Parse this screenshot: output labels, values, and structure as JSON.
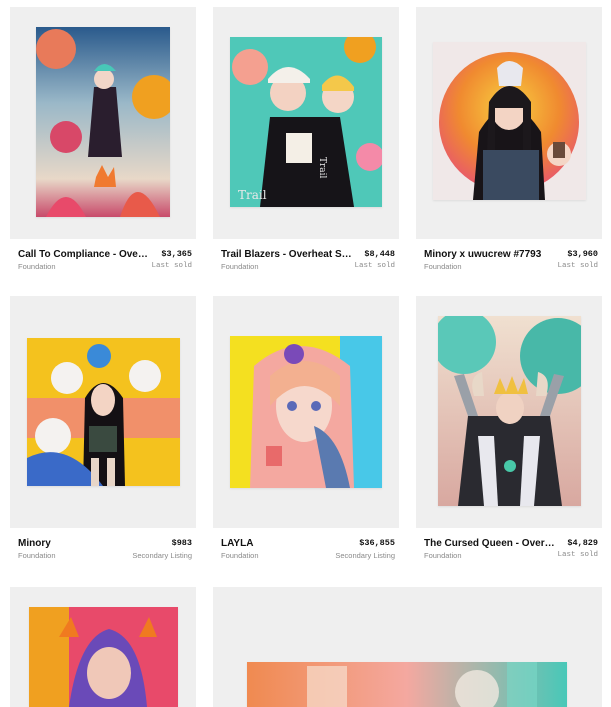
{
  "cards": [
    {
      "title": "Call To Compliance - Overheat Series",
      "price": "$3,365",
      "platform": "Foundation",
      "status": "Last sold",
      "image_alt": "Call To Compliance artwork"
    },
    {
      "title": "Trail Blazers - Overheat Series",
      "price": "$8,448",
      "platform": "Foundation",
      "status": "Last sold",
      "image_alt": "Trail Blazers artwork"
    },
    {
      "title": "Minory x uwucrew #7793",
      "price": "$3,960",
      "platform": "Foundation",
      "status": "Last sold",
      "image_alt": "Minory x uwucrew artwork"
    },
    {
      "title": "Minory",
      "price": "$983",
      "platform": "Foundation",
      "status": "Secondary Listing",
      "image_alt": "Minory artwork"
    },
    {
      "title": "LAYLA",
      "price": "$36,855",
      "platform": "Foundation",
      "status": "Secondary Listing",
      "image_alt": "LAYLA artwork"
    },
    {
      "title": "The Cursed Queen - Overheat Series",
      "price": "$4,829",
      "platform": "Foundation",
      "status": "Last sold",
      "image_alt": "The Cursed Queen artwork"
    }
  ],
  "palette": {
    "card_bg": "#efefef",
    "muted_text": "#8a8a8a"
  }
}
